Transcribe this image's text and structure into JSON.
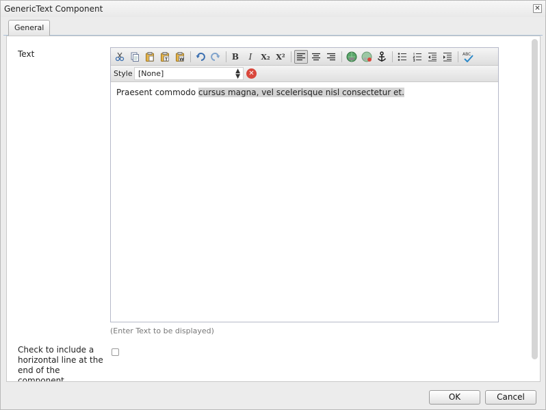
{
  "window": {
    "title": "GenericText Component"
  },
  "tabs": [
    {
      "label": "General"
    }
  ],
  "text_field": {
    "label": "Text",
    "content_plain": "Praesent commodo ",
    "content_selected": "cursus magna, vel scelerisque nisl consectetur et.",
    "hint": "(Enter Text to be displayed)"
  },
  "toolbar": {
    "buttons": [
      "cut-icon",
      "copy-icon",
      "paste-icon",
      "paste-plaintext-icon",
      "paste-wordhtml-icon",
      "undo-icon",
      "redo-icon",
      "bold-icon",
      "italic-icon",
      "subscript-icon",
      "superscript-icon",
      "justify-left-icon",
      "justify-center-icon",
      "justify-right-icon",
      "link-icon",
      "unlink-icon",
      "anchor-icon",
      "bulleted-list-icon",
      "numbered-list-icon",
      "outdent-icon",
      "indent-icon",
      "spellcheck-icon"
    ],
    "bold_glyph": "B",
    "italic_glyph": "I",
    "subscript_glyph": "X₂",
    "superscript_glyph": "X²"
  },
  "style_bar": {
    "label": "Style",
    "selected": "[None]"
  },
  "horizontal_line": {
    "label": "Check to include a horizontal line at the end of the component",
    "checked": false
  },
  "footer": {
    "ok_label": "OK",
    "cancel_label": "Cancel"
  },
  "colors": {
    "selection": "#d4d4d4",
    "clear_button": "#d9473c",
    "tab_border": "#a9bfd6"
  }
}
